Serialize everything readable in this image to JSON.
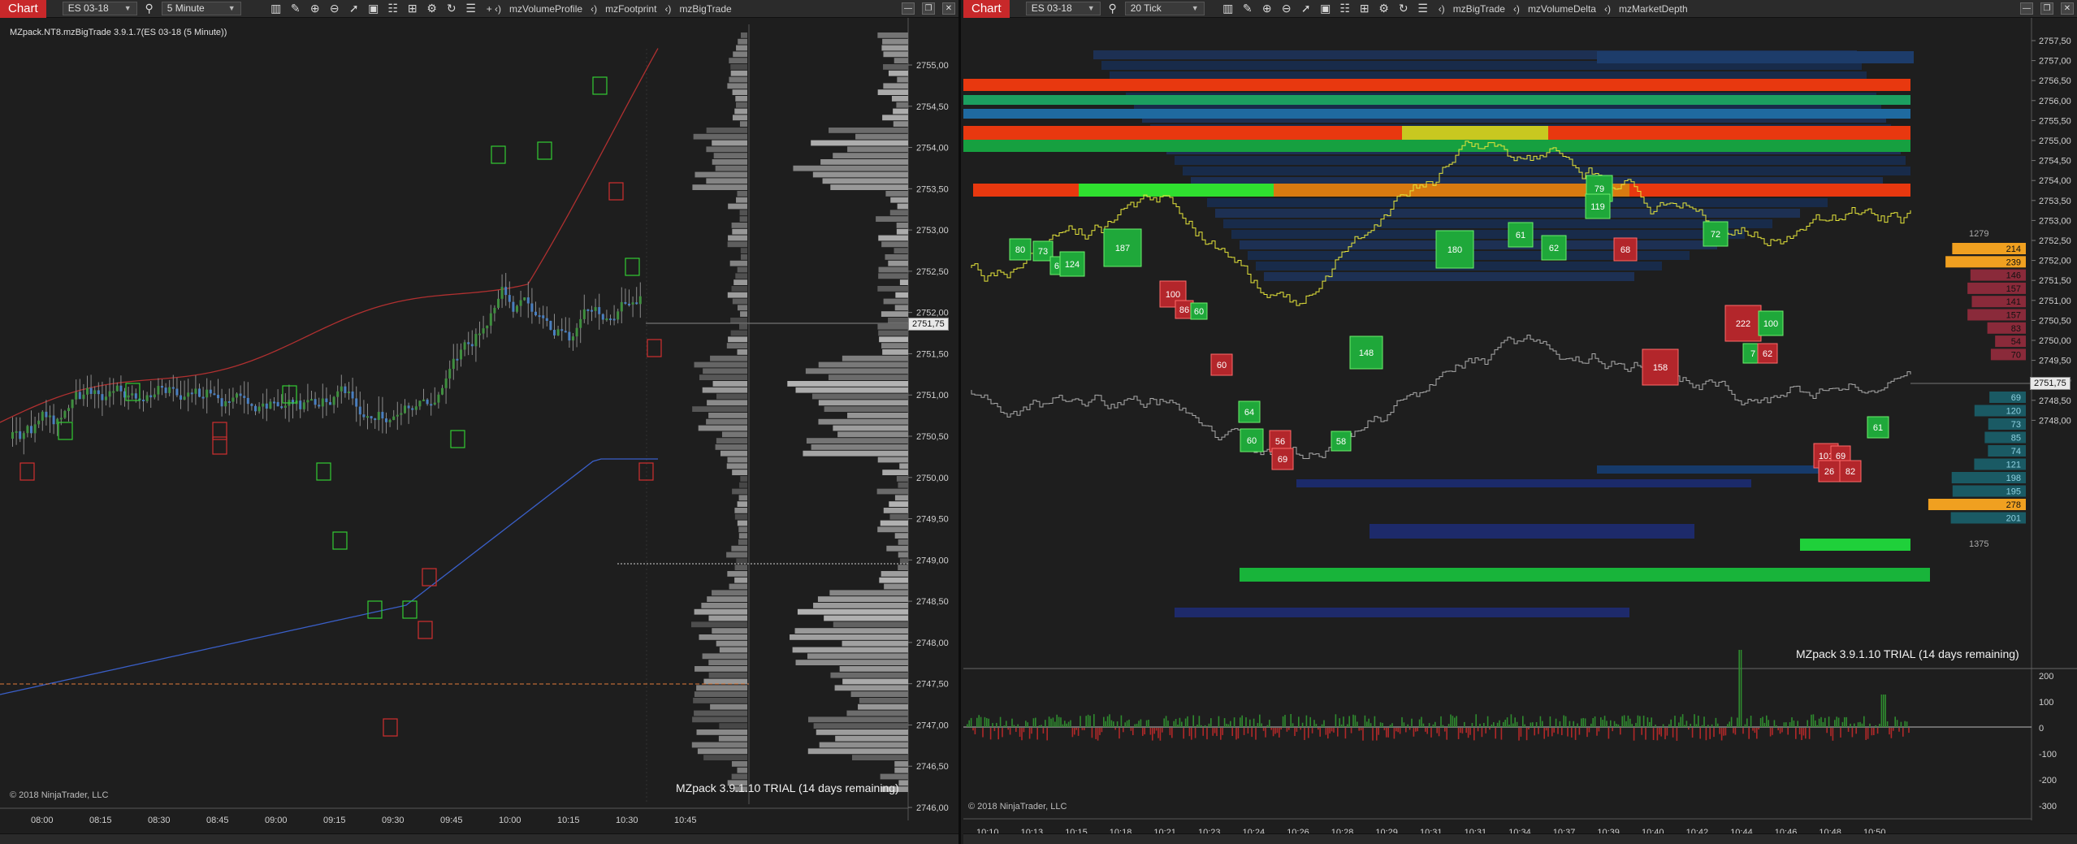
{
  "left": {
    "toolbar": {
      "chart_label": "Chart",
      "instrument": "ES 03-18",
      "interval": "5 Minute",
      "indicators": [
        "mzVolumeProfile",
        "mzFootprint",
        "mzBigTrade"
      ]
    },
    "title": "MZpack.NT8.mzBigTrade 3.9.1.7(ES 03-18 (5 Minute))",
    "copyright": "© 2018 NinjaTrader, LLC",
    "trial": "MZpack 3.9.1.10 TRIAL  (14 days remaining)",
    "price_axis": [
      "2755,00",
      "2754,50",
      "2754,00",
      "2753,50",
      "2753,00",
      "2752,50",
      "2752,00",
      "2751,50",
      "2751,00",
      "2750,50",
      "2750,00",
      "2749,50",
      "2749,00",
      "2748,50",
      "2748,00",
      "2747,50",
      "2747,00",
      "2746,50",
      "2746,00"
    ],
    "last_price": "2751,75",
    "time_axis": [
      "08:00",
      "08:15",
      "08:30",
      "08:45",
      "09:00",
      "09:15",
      "09:30",
      "09:45",
      "10:00",
      "10:15",
      "10:30",
      "10:45"
    ]
  },
  "right": {
    "toolbar": {
      "chart_label": "Chart",
      "instrument": "ES 03-18",
      "interval": "20 Tick",
      "indicators": [
        "mzBigTrade",
        "mzVolumeDelta",
        "mzMarketDepth"
      ]
    },
    "copyright": "© 2018 NinjaTrader, LLC",
    "trial": "MZpack 3.9.1.10 TRIAL  (14 days remaining)",
    "price_axis": [
      "2757,50",
      "2757,00",
      "2756,50",
      "2756,00",
      "2755,50",
      "2755,00",
      "2754,50",
      "2754,00",
      "2753,50",
      "2753,00",
      "2752,50",
      "2752,00",
      "2751,50",
      "2751,00",
      "2750,50",
      "2750,00",
      "2749,50",
      "2749,00",
      "2748,50",
      "2748,00"
    ],
    "last_price": "2751,75",
    "delta_axis": [
      "200",
      "100",
      "0",
      "-100",
      "-200",
      "-300"
    ],
    "time_axis": [
      "10:10",
      "10:13",
      "10:15",
      "10:18",
      "10:21",
      "10:23",
      "10:24",
      "10:26",
      "10:28",
      "10:29",
      "10:31",
      "10:31",
      "10:34",
      "10:37",
      "10:39",
      "10:40",
      "10:42",
      "10:44",
      "10:46",
      "10:48",
      "10:50"
    ],
    "depth_ask_total": "1279",
    "depth_bid_total": "1375",
    "depth_ask": [
      "214",
      "239",
      "146",
      "157",
      "141",
      "157",
      "83",
      "54",
      "70"
    ],
    "depth_bid": [
      "69",
      "120",
      "73",
      "85",
      "74",
      "121",
      "198",
      "195",
      "278",
      "201"
    ],
    "big_trades": [
      {
        "v": "80",
        "c": "g"
      },
      {
        "v": "73",
        "c": "g"
      },
      {
        "v": "61",
        "c": "g"
      },
      {
        "v": "124",
        "c": "g"
      },
      {
        "v": "187",
        "c": "g"
      },
      {
        "v": "100",
        "c": "r"
      },
      {
        "v": "86",
        "c": "r"
      },
      {
        "v": "60",
        "c": "g"
      },
      {
        "v": "60",
        "c": "r"
      },
      {
        "v": "64",
        "c": "g"
      },
      {
        "v": "60",
        "c": "g"
      },
      {
        "v": "56",
        "c": "r"
      },
      {
        "v": "69",
        "c": "r"
      },
      {
        "v": "58",
        "c": "g"
      },
      {
        "v": "148",
        "c": "g"
      },
      {
        "v": "180",
        "c": "g"
      },
      {
        "v": "61",
        "c": "g"
      },
      {
        "v": "62",
        "c": "g"
      },
      {
        "v": "79",
        "c": "g"
      },
      {
        "v": "119",
        "c": "g"
      },
      {
        "v": "68",
        "c": "r"
      },
      {
        "v": "158",
        "c": "r"
      },
      {
        "v": "72",
        "c": "g"
      },
      {
        "v": "222",
        "c": "r"
      },
      {
        "v": "100",
        "c": "g"
      },
      {
        "v": "7",
        "c": "g"
      },
      {
        "v": "62",
        "c": "r"
      },
      {
        "v": "61",
        "c": "g"
      },
      {
        "v": "101",
        "c": "r"
      },
      {
        "v": "69",
        "c": "r"
      },
      {
        "v": "26",
        "c": "r"
      },
      {
        "v": "82",
        "c": "r"
      }
    ]
  }
}
